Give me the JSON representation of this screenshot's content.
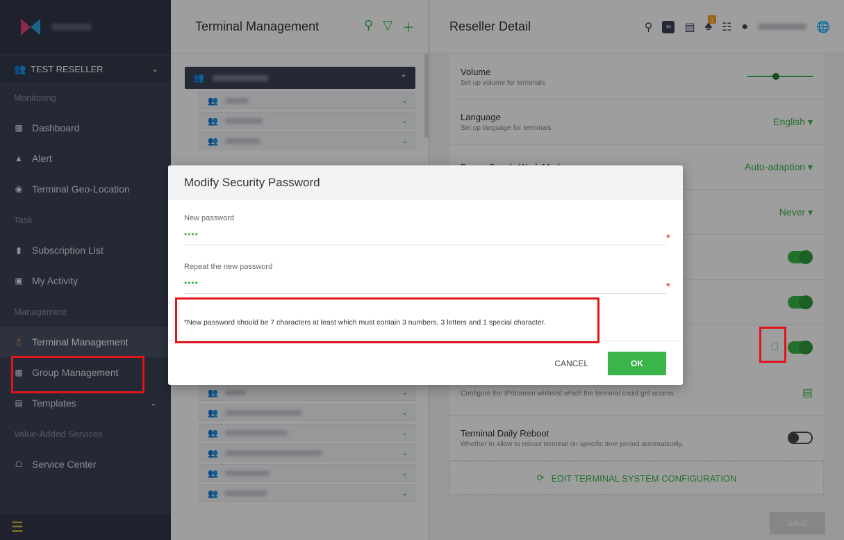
{
  "sidebar": {
    "reseller_label": "TEST RESELLER",
    "sections": {
      "monitoring": "Monitoring",
      "task": "Task",
      "management": "Management",
      "value_added": "Value-Added Services"
    },
    "items": {
      "dashboard": "Dashboard",
      "alert": "Alert",
      "geo": "Terminal Geo-Location",
      "subscription": "Subscription List",
      "activity": "My Activity",
      "terminal_mgmt": "Terminal Management",
      "group_mgmt": "Group Management",
      "templates": "Templates",
      "service_center": "Service Center"
    }
  },
  "middle": {
    "title": "Terminal Management"
  },
  "right": {
    "title": "Reseller Detail",
    "notification_count": "1",
    "settings": {
      "volume": {
        "title": "Volume",
        "desc": "Set up volume for terminals",
        "level": 0.4
      },
      "language": {
        "title": "Language",
        "desc": "Set up language for terminals",
        "value": "English"
      },
      "power": {
        "title": "Power Supply Work Mode",
        "value": "Auto-adaption"
      },
      "sleep": {
        "value": "Never"
      },
      "whitelist": {
        "desc": "Configure the IP/domain whitelist which the terminal could get access"
      },
      "reboot": {
        "title": "Terminal Daily Reboot",
        "desc": "Whether to allow to reboot terminal on specific time period automatically."
      }
    },
    "edit_config_label": "EDIT TERMINAL SYSTEM CONFIGURATION",
    "save_label": "SAVE"
  },
  "modal": {
    "title": "Modify Security Password",
    "new_password_label": "New password",
    "new_password_value": "••••",
    "repeat_password_label": "Repeat the new password",
    "repeat_password_value": "••••",
    "required_mark": "*",
    "hint": "*New password should be 7 characters at least which must contain 3 numbers, 3 letters and 1 special character.",
    "cancel_label": "CANCEL",
    "ok_label": "OK"
  },
  "colors": {
    "accent": "#3bb54a",
    "sidebar_bg": "#3d4358",
    "highlight": "#e0141a",
    "required": "#e0302f"
  }
}
